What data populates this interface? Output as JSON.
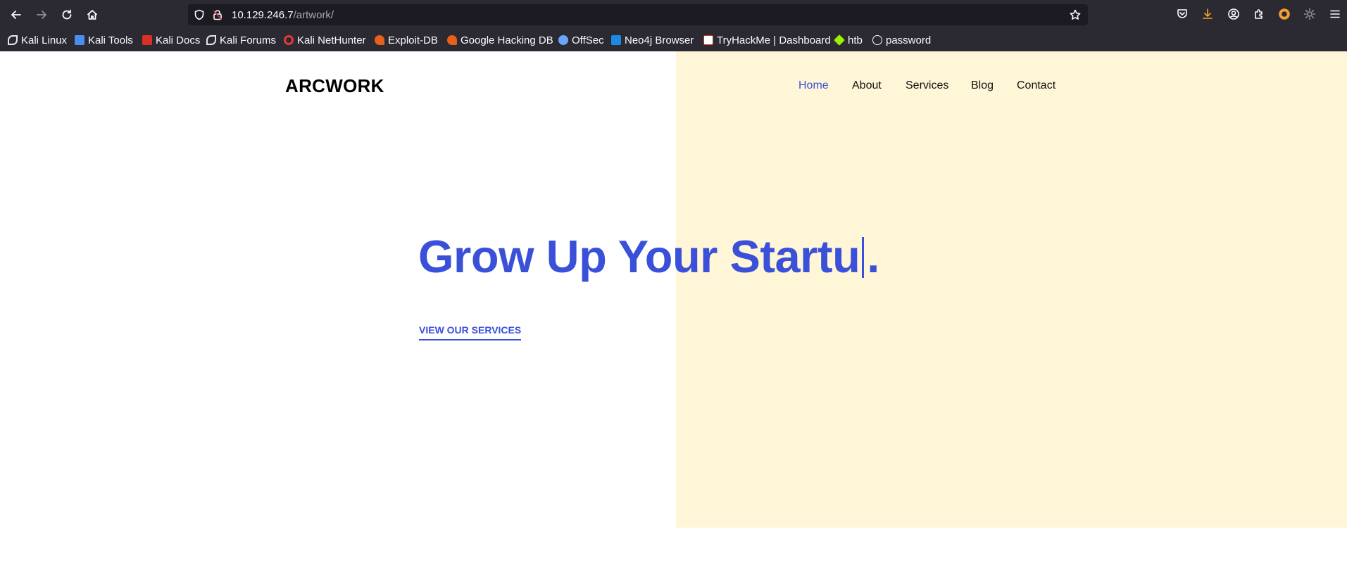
{
  "browser": {
    "url_host": "10.129.246.7",
    "url_path": "/artwork/",
    "bookmarks": [
      {
        "label": "Kali Linux",
        "icon": "kali-dragon-icon",
        "color": "#e6e6e6"
      },
      {
        "label": "Kali Tools",
        "icon": "kali-tools-icon",
        "color": "#4a8df0"
      },
      {
        "label": "Kali Docs",
        "icon": "kali-docs-icon",
        "color": "#d93025"
      },
      {
        "label": "Kali Forums",
        "icon": "kali-dragon-icon",
        "color": "#e6e6e6"
      },
      {
        "label": "Kali NetHunter",
        "icon": "nethunter-icon",
        "color": "#e53935"
      },
      {
        "label": "Exploit-DB",
        "icon": "exploit-db-icon",
        "color": "#e8611a"
      },
      {
        "label": "Google Hacking DB",
        "icon": "exploit-db-icon",
        "color": "#e8611a"
      },
      {
        "label": "OffSec",
        "icon": "offsec-icon",
        "color": "#6aa6f8"
      },
      {
        "label": "Neo4j Browser",
        "icon": "terminal-icon",
        "color": "#1e88e5"
      },
      {
        "label": "TryHackMe | Dashboard",
        "icon": "tryhackme-icon",
        "color": "#ffffff"
      },
      {
        "label": "htb",
        "icon": "htb-cube-icon",
        "color": "#9fef00"
      },
      {
        "label": "password",
        "icon": "globe-icon",
        "color": "#fbfbfe"
      }
    ]
  },
  "site": {
    "brand": "ARCWORK",
    "nav": [
      {
        "label": "Home",
        "active": true
      },
      {
        "label": "About",
        "active": false
      },
      {
        "label": "Services",
        "active": false
      },
      {
        "label": "Blog",
        "active": false
      },
      {
        "label": "Contact",
        "active": false
      }
    ],
    "hero": {
      "title_before_cursor": "Grow Up Your Startu",
      "title_after_cursor": ".",
      "cta": "VIEW OUR SERVICES"
    },
    "colors": {
      "accent": "#3a50d9",
      "panel": "#fff5d7"
    }
  }
}
